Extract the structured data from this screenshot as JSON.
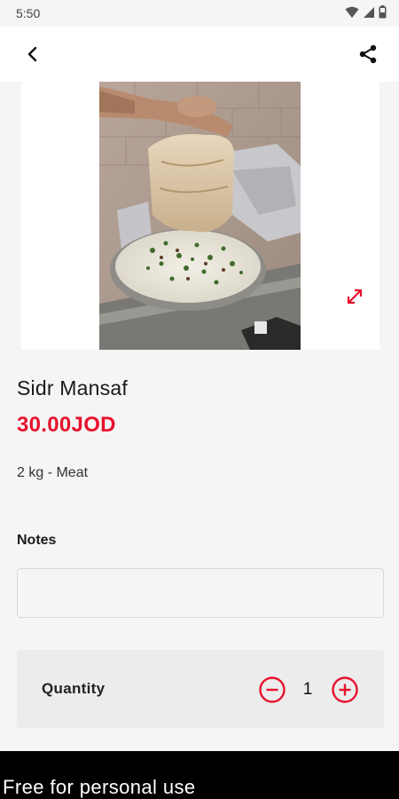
{
  "status_bar": {
    "time": "5:50",
    "icons": [
      "wifi-icon",
      "signal-icon",
      "battery-icon"
    ]
  },
  "app_bar": {
    "back_icon": "back-arrow-icon",
    "share_icon": "share-icon"
  },
  "product": {
    "name": "Sidr Mansaf",
    "price": "30.00JOD",
    "description": "2 kg - Meat",
    "expand_icon": "expand-icon"
  },
  "notes": {
    "label": "Notes",
    "value": ""
  },
  "quantity": {
    "label": "Quantity",
    "value": "1",
    "minus_icon": "minus-circle-icon",
    "plus_icon": "plus-circle-icon"
  },
  "watermark": {
    "text": "Free for personal use"
  },
  "colors": {
    "accent": "#e8112d",
    "background": "#f5f5f5",
    "card": "#ececec",
    "watermark_bg": "#000000"
  }
}
